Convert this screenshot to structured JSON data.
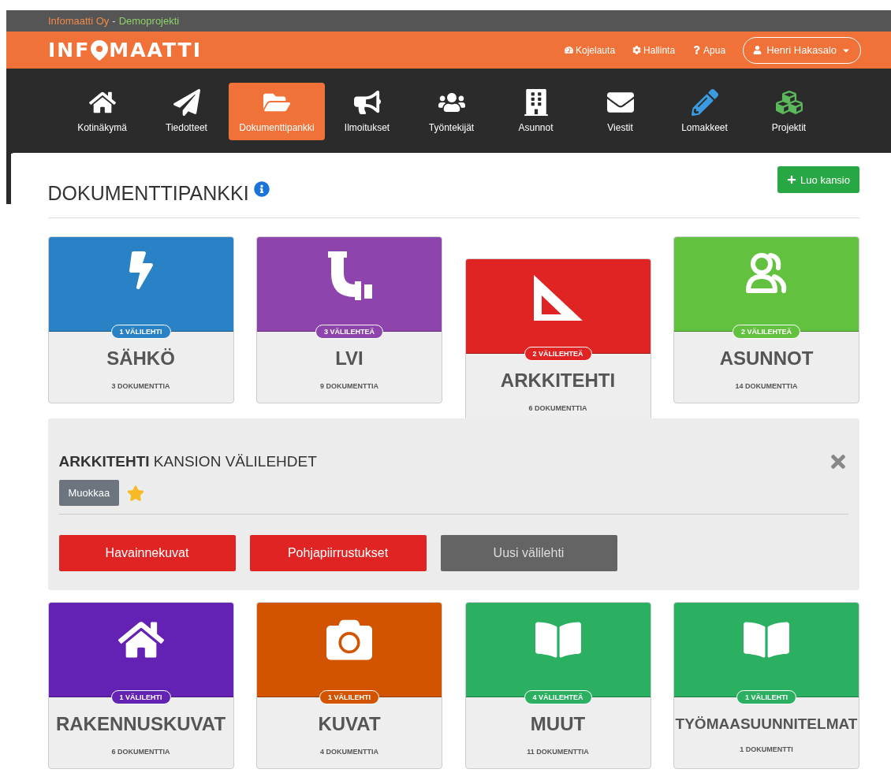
{
  "top_bar": {
    "company": "Infomaatti Oy",
    "separator": "-",
    "project": "Demoprojekti"
  },
  "header": {
    "logo_parts": [
      "INF",
      "MAATTI"
    ],
    "links": [
      "Kojelauta",
      "Hallinta",
      "Apua"
    ],
    "user": "Henri Hakasalo"
  },
  "nav": [
    {
      "label": "Kotinäkymä",
      "selected": false
    },
    {
      "label": "Tiedotteet",
      "selected": false
    },
    {
      "label": "Dokumenttipankki",
      "selected": true
    },
    {
      "label": "Ilmoitukset",
      "selected": false
    },
    {
      "label": "Työntekijät",
      "selected": false
    },
    {
      "label": "Asunnot",
      "selected": false
    },
    {
      "label": "Viestit",
      "selected": false
    },
    {
      "label": "Lomakkeet",
      "selected": false
    },
    {
      "label": "Projektit",
      "selected": false
    }
  ],
  "page": {
    "title": "DOKUMENTTIPANKKI",
    "create_button": "Luo kansio"
  },
  "folders_top": [
    {
      "name": "SÄHKÖ",
      "tabs": "1 VÄLILEHTI",
      "documents": "3 DOKUMENTTIA",
      "color": "#2a82c6",
      "selected": false
    },
    {
      "name": "LVI",
      "tabs": "3 VÄLILEHTEÄ",
      "documents": "9 DOKUMENTTIA",
      "color": "#8e44ad",
      "selected": false
    },
    {
      "name": "ARKKITEHTI",
      "tabs": "2 VÄLILEHTEÄ",
      "documents": "6 DOKUMENTTIA",
      "color": "#e02424",
      "selected": true
    },
    {
      "name": "ASUNNOT",
      "tabs": "2 VÄLILEHTEÄ",
      "documents": "14 DOKUMENTTIA",
      "color": "#62c13e",
      "selected": false
    }
  ],
  "panel": {
    "folder": "ARKKITEHTI",
    "title_rest": "KANSION VÄLILEHDET",
    "edit_button": "Muokkaa",
    "favorite": true,
    "tabs": [
      {
        "label": "Havainnekuvat",
        "kind": "tab"
      },
      {
        "label": "Pohjapiirrustukset",
        "kind": "tab"
      },
      {
        "label": "Uusi välilehti",
        "kind": "new"
      }
    ]
  },
  "folders_bottom": [
    {
      "name": "RAKENNUSKUVAT",
      "tabs": "1 VÄLILEHTI",
      "documents": "6 DOKUMENTTIA",
      "color": "#6422b5",
      "selected": false
    },
    {
      "name": "KUVAT",
      "tabs": "1 VÄLILEHTI",
      "documents": "4 DOKUMENTTIA",
      "color": "#d35400",
      "selected": false
    },
    {
      "name": "MUUT",
      "tabs": "4 VÄLILEHTEÄ",
      "documents": "11 DOKUMENTTIA",
      "color": "#2bb062",
      "selected": false
    },
    {
      "name": "TYÖMAASUUNNITELMAT",
      "tabs": "1 VÄLILEHTI",
      "documents": "1 DOKUMENTTI",
      "color": "#2bb062",
      "selected": false
    }
  ]
}
